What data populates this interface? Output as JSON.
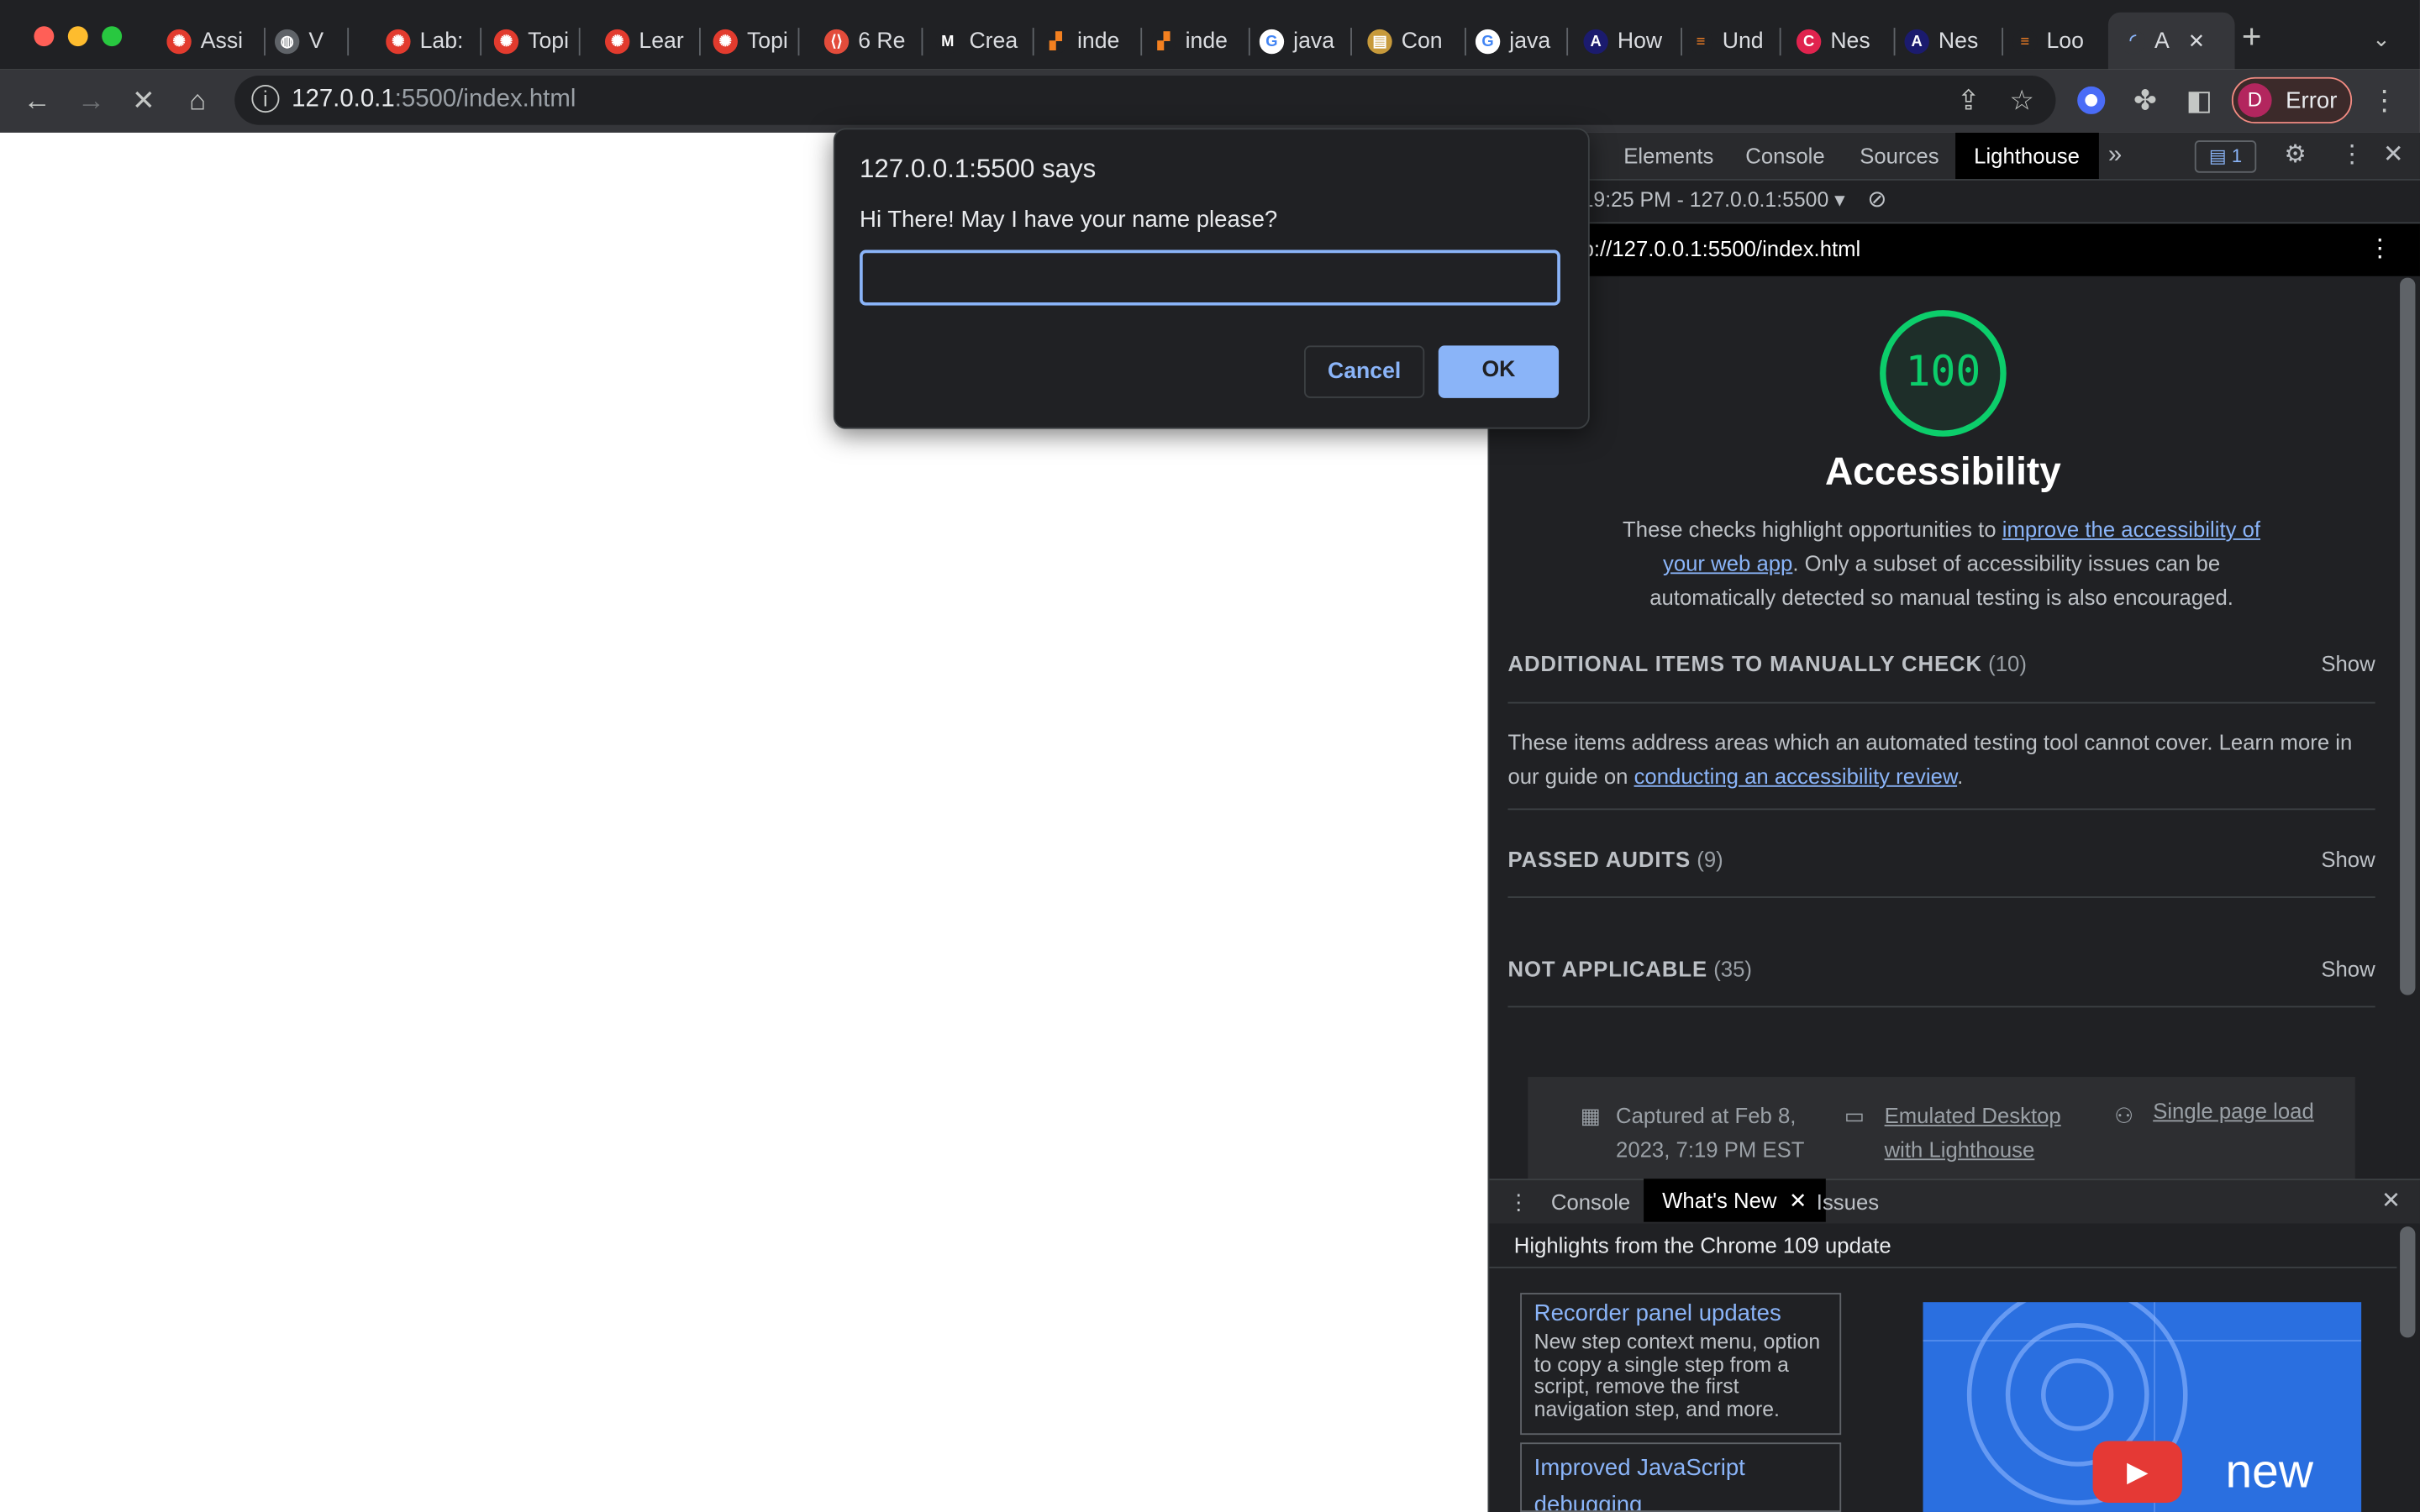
{
  "browser": {
    "tabs": [
      {
        "label": "Assi",
        "icon": "canvas-icon"
      },
      {
        "label": "V",
        "icon": "globe-icon"
      },
      {
        "label": "Lab:",
        "icon": "canvas-icon"
      },
      {
        "label": "Topi",
        "icon": "canvas-icon"
      },
      {
        "label": "Lear",
        "icon": "canvas-icon"
      },
      {
        "label": "Topi",
        "icon": "canvas-icon"
      },
      {
        "label": "6 Re",
        "icon": "shield-code-icon"
      },
      {
        "label": "Crea",
        "icon": "m-logo-icon"
      },
      {
        "label": "inde",
        "icon": "orange-blocks-icon"
      },
      {
        "label": "inde",
        "icon": "orange-blocks-icon"
      },
      {
        "label": "java",
        "icon": "google-icon"
      },
      {
        "label": "Con",
        "icon": "note-icon"
      },
      {
        "label": "java",
        "icon": "google-icon"
      },
      {
        "label": "How",
        "icon": "a-logo-icon"
      },
      {
        "label": "Und",
        "icon": "stackoverflow-icon"
      },
      {
        "label": "Nes",
        "icon": "red-c-icon"
      },
      {
        "label": "Nes",
        "icon": "a-logo-icon"
      },
      {
        "label": "Loo",
        "icon": "stackoverflow-icon"
      },
      {
        "label": "A",
        "icon": "loading-spinner-icon"
      }
    ],
    "url_host": "127.0.0.1",
    "url_rest": ":5500/index.html",
    "profile_initial": "D",
    "profile_status": "Error"
  },
  "devtools": {
    "tabs": [
      "Elements",
      "Console",
      "Sources",
      "Lighthouse"
    ],
    "issues_count": "1",
    "report_selector": "19:25 PM - 127.0.0.1:5500",
    "report_url": "p://127.0.0.1:5500/index.html",
    "score": "100",
    "category": "Accessibility",
    "desc_prefix": "These checks highlight opportunities to ",
    "desc_link": "improve the accessibility of your web app",
    "desc_suffix": ". Only a subset of accessibility issues can be automatically detected so manual testing is also encouraged.",
    "groups": [
      {
        "title": "ADDITIONAL ITEMS TO MANUALLY CHECK",
        "count": "(10)",
        "action": "Show"
      },
      {
        "title": "PASSED AUDITS",
        "count": "(9)",
        "action": "Show"
      },
      {
        "title": "NOT APPLICABLE",
        "count": "(35)",
        "action": "Show"
      }
    ],
    "manual_desc_prefix": "These items address areas which an automated testing tool cannot cover. Learn more in our guide on ",
    "manual_desc_link": "conducting an accessibility review",
    "manual_desc_suffix": ".",
    "footer": {
      "captured_line1": "Captured at Feb 8,",
      "captured_line2": "2023, 7:19 PM EST",
      "device_line1": "Emulated Desktop",
      "device_line2": "with Lighthouse",
      "load": "Single page load"
    },
    "drawer": {
      "tabs": [
        "Console",
        "What's New",
        "Issues"
      ],
      "highlight": "Highlights from the Chrome 109 update",
      "cards": [
        {
          "title": "Recorder panel updates",
          "body": "New step context menu, option to copy a single step from a script, remove the first navigation step, and more."
        },
        {
          "title": "Improved JavaScript debugging",
          "body": ""
        }
      ],
      "video_text": "new"
    }
  },
  "dialog": {
    "title": "127.0.0.1:5500 says",
    "message": "Hi There! May I have your name please?",
    "input_value": "",
    "cancel": "Cancel",
    "ok": "OK"
  },
  "colors": {
    "accent": "#8ab4f8",
    "score_green": "#0cce6b",
    "tab_bg": "#202124",
    "toolbar_bg": "#35363a"
  }
}
